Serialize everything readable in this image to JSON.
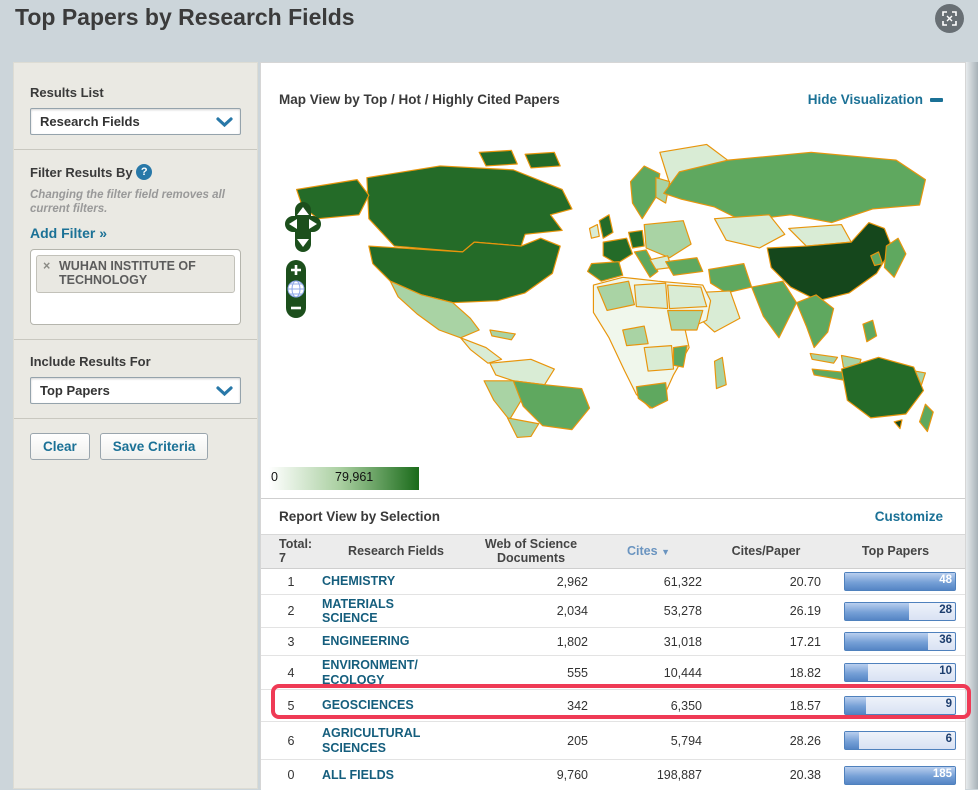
{
  "page": {
    "title": "Top Papers by Research Fields"
  },
  "sidebar": {
    "results_list": {
      "label": "Results List",
      "value": "Research Fields"
    },
    "filter": {
      "label": "Filter Results By",
      "help_glyph": "?",
      "note": "Changing the filter field removes all current filters.",
      "add_link": "Add Filter »",
      "tag": "WUHAN INSTITUTE OF TECHNOLOGY",
      "tag_close": "×"
    },
    "include": {
      "label": "Include Results For",
      "value": "Top Papers"
    },
    "buttons": {
      "clear": "Clear",
      "save": "Save Criteria"
    }
  },
  "viz": {
    "title": "Map View by Top / Hot / Highly Cited Papers",
    "hide_link": "Hide Visualization",
    "scale_min": "0",
    "scale_max": "79,961"
  },
  "report": {
    "title": "Report View by Selection",
    "customize": "Customize",
    "total_label": "Total:",
    "total_value": "7",
    "col_field": "Research Fields",
    "col_docs": "Web of Science Documents",
    "col_cites": "Cites",
    "sort_icon": "▼",
    "col_cpp": "Cites/Paper",
    "col_top": "Top Papers",
    "rows": [
      {
        "rank": "1",
        "field": "CHEMISTRY",
        "docs": "2,962",
        "cites": "61,322",
        "cpp": "20.70",
        "top": "48",
        "fill": 100
      },
      {
        "rank": "2",
        "field": "MATERIALS SCIENCE",
        "docs": "2,034",
        "cites": "53,278",
        "cpp": "26.19",
        "top": "28",
        "fill": 58
      },
      {
        "rank": "3",
        "field": "ENGINEERING",
        "docs": "1,802",
        "cites": "31,018",
        "cpp": "17.21",
        "top": "36",
        "fill": 75
      },
      {
        "rank": "4",
        "field": "ENVIRONMENT/ECOLOGY",
        "docs": "555",
        "cites": "10,444",
        "cpp": "18.82",
        "top": "10",
        "fill": 21
      },
      {
        "rank": "5",
        "field": "GEOSCIENCES",
        "docs": "342",
        "cites": "6,350",
        "cpp": "18.57",
        "top": "9",
        "fill": 19,
        "highlighted": true
      },
      {
        "rank": "6",
        "field": "AGRICULTURAL SCIENCES",
        "docs": "205",
        "cites": "5,794",
        "cpp": "28.26",
        "top": "6",
        "fill": 13
      },
      {
        "rank": "0",
        "field": "ALL FIELDS",
        "docs": "9,760",
        "cites": "198,887",
        "cpp": "20.38",
        "top": "185",
        "fill": 100
      }
    ]
  },
  "colors": {
    "link_blue": "#1b7196",
    "field_link": "#155e7d",
    "bar_border": "#4f81bd",
    "highlight_red": "#ef3a55",
    "map_border_orange": "#e8950c",
    "map_dark_green": "#246b28",
    "map_darkest_green": "#15471c",
    "scale_max_green": "#1a6b1a",
    "page_bg": "#ccd5da"
  }
}
